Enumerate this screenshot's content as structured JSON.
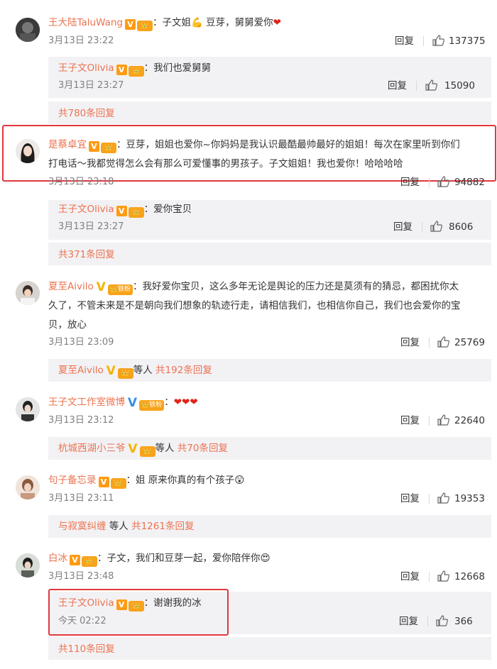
{
  "comments": [
    {
      "user": "王大陆TaluWang",
      "text": "：子文姐💪 豆芽，舅舅爱你",
      "text_suffix": "❤",
      "time": "3月13日 23:22",
      "likes": "137375",
      "sub": {
        "user": "王子文Olivia",
        "text": "：我们也爱舅舅",
        "time": "3月13日 23:27",
        "likes": "15090"
      },
      "more": "共780条回复"
    },
    {
      "user": "是蔡卓宜",
      "text_line1": "：豆芽，姐姐也爱你~你妈妈是我认识最酷最帅最好的姐姐！每次在家里听到你们",
      "text_line2": "打电话～我都觉得怎么会有那么可爱懂事的男孩子。子文姐姐！我也爱你！哈哈哈哈",
      "time": "3月13日 23:18",
      "likes": "94882",
      "sub": {
        "user": "王子文Olivia",
        "text": "：爱你宝贝",
        "time": "3月13日 23:27",
        "likes": "8606"
      },
      "more": "共371条回复"
    },
    {
      "user": "夏至Aivilo",
      "fan_badge": "铁粉",
      "text_line1": "：我好爱你宝贝，这么多年无论是舆论的压力还是莫须有的猜忌，都困扰你太",
      "text_line2": "久了，不管未来是不是朝向我们想象的轨迹行走，请相信我们，也相信你自己，我们也会爱你的宝",
      "text_line3": "贝，放心",
      "time": "3月13日 23:09",
      "likes": "25769",
      "more_user": "夏至Aivilo",
      "more_others": "等人",
      "more": "共192条回复"
    },
    {
      "user": "王子文工作室微博",
      "fan_badge": "铁粉",
      "text": "：",
      "hearts": "❤❤❤",
      "time": "3月13日 23:12",
      "likes": "22640",
      "more_user": "杭城西湖小三爷",
      "more_others": "等人",
      "more": "共70条回复"
    },
    {
      "user": "句子备忘录",
      "text": "：姐 原来你真的有个孩子",
      "text_suffix": "😲",
      "time": "3月13日 23:11",
      "likes": "19353",
      "more_user": "与寂寞纠缠",
      "more_others": "等人",
      "more": "共1261条回复"
    },
    {
      "user": "白冰",
      "text": "：子文，我们和豆芽一起，爱你陪伴你",
      "text_suffix": "😍",
      "time": "3月13日 23:48",
      "likes": "12668",
      "sub": {
        "user": "王子文Olivia",
        "text": "：谢谢我的冰",
        "time": "今天 02:22",
        "likes": "366"
      },
      "more": "共110条回复"
    }
  ],
  "reply_label": "回复",
  "badge_v": "V",
  "crown_icon": "crown-badge",
  "colors": {
    "username": "#eb7350",
    "highlight": "#e0383e",
    "subbg": "#f2f2f5"
  }
}
